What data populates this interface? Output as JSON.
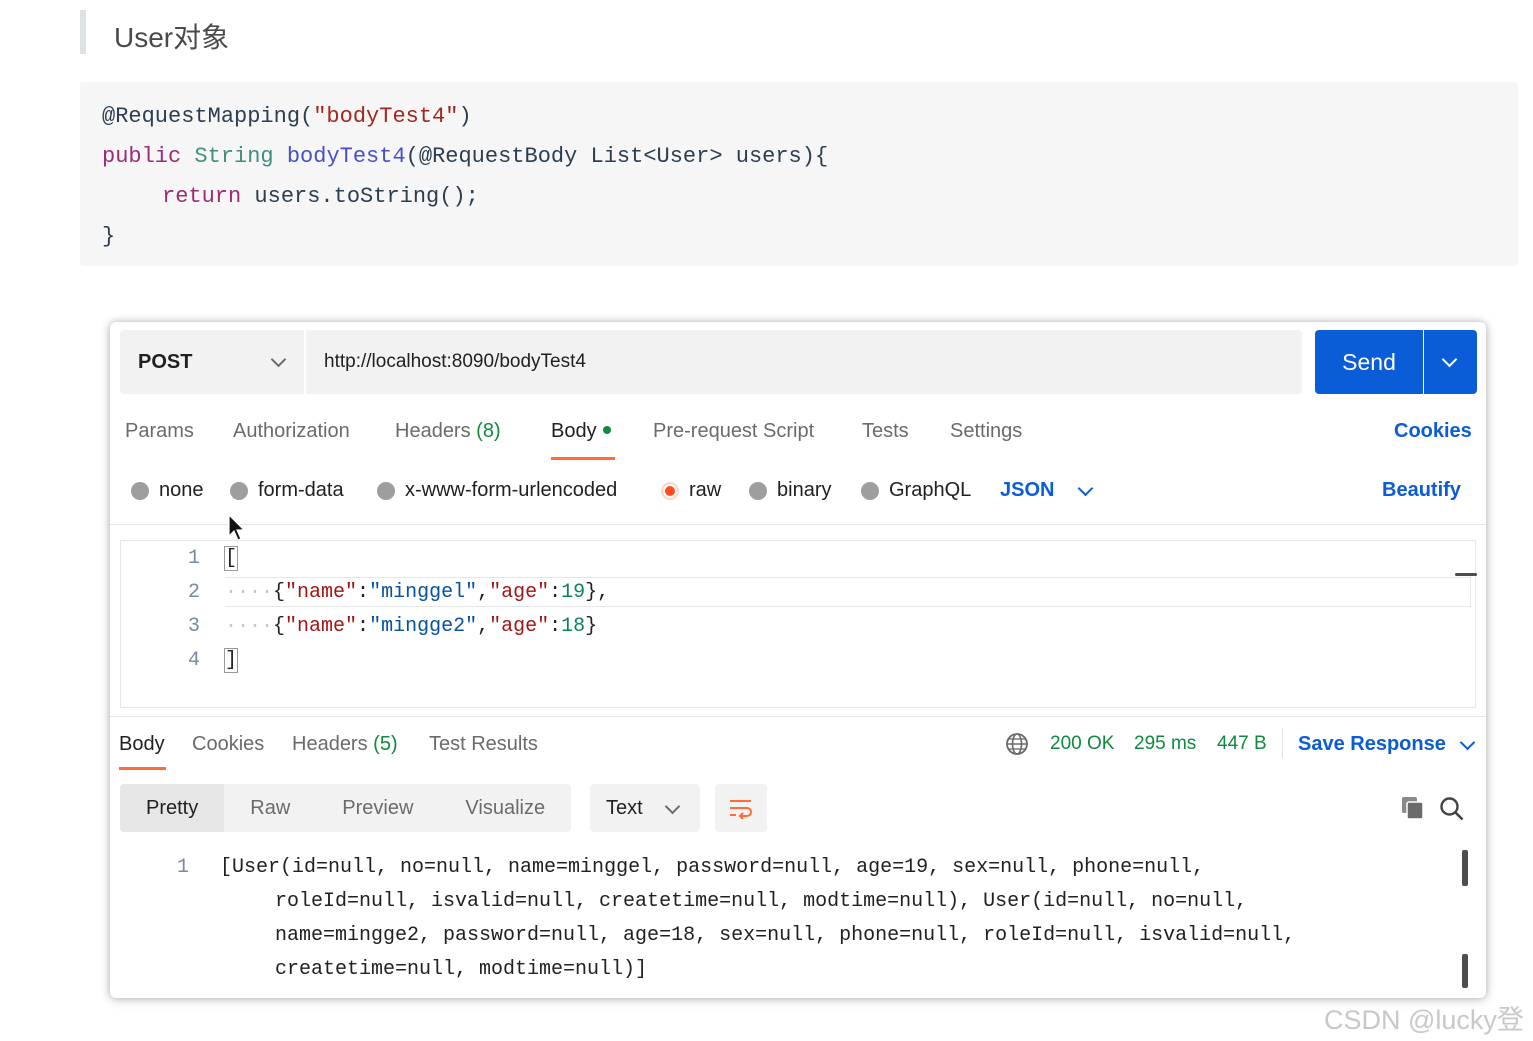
{
  "doc": {
    "heading": "User对象",
    "code_lines": [
      [
        "@RequestMapping(",
        "\"bodyTest4\"",
        ")"
      ],
      [
        "public",
        "String",
        "bodyTest4",
        "(@RequestBody ",
        "List<User>",
        " users){"
      ],
      [
        "return",
        " users.toString();"
      ],
      [
        "}"
      ]
    ]
  },
  "request": {
    "method": "POST",
    "url": "http://localhost:8090/bodyTest4",
    "send_label": "Send",
    "tabs": {
      "params": "Params",
      "authorization": "Authorization",
      "headers": "Headers",
      "headers_count": "(8)",
      "body": "Body",
      "prerequest": "Pre-request Script",
      "tests": "Tests",
      "settings": "Settings"
    },
    "cookies_link": "Cookies",
    "body_types": {
      "none": "none",
      "form_data": "form-data",
      "urlencoded": "x-www-form-urlencoded",
      "raw": "raw",
      "binary": "binary",
      "graphql": "GraphQL"
    },
    "selected_body_type": "raw",
    "format": "JSON",
    "beautify": "Beautify",
    "editor": {
      "line_numbers": [
        "1",
        "2",
        "3",
        "4"
      ],
      "line1": "[",
      "line4": "]",
      "rows": [
        {
          "k1": "\"name\"",
          "v1": "\"minggel\"",
          "k2": "\"age\"",
          "v2": "19",
          "end": "},"
        },
        {
          "k1": "\"name\"",
          "v1": "\"mingge2\"",
          "k2": "\"age\"",
          "v2": "18",
          "end": "}"
        }
      ]
    }
  },
  "response": {
    "tabs": {
      "body": "Body",
      "cookies": "Cookies",
      "headers": "Headers",
      "headers_count": "(5)",
      "test_results": "Test Results"
    },
    "status": "200 OK",
    "time": "295 ms",
    "size": "447 B",
    "save_response": "Save Response",
    "views": {
      "pretty": "Pretty",
      "raw": "Raw",
      "preview": "Preview",
      "visualize": "Visualize"
    },
    "format": "Text",
    "line_number": "1",
    "body_lines": [
      "[User(id=null, no=null, name=minggel, password=null, age=19, sex=null, phone=null,",
      "roleId=null, isvalid=null, createtime=null, modtime=null), User(id=null, no=null,",
      "name=mingge2, password=null, age=18, sex=null, phone=null, roleId=null, isvalid=null,",
      "createtime=null, modtime=null)]"
    ]
  },
  "watermark": "CSDN @lucky登",
  "colors": {
    "accent_blue": "#0b5cd7",
    "tab_underline": "#ff6c37",
    "status_green": "#0f8a3f"
  }
}
